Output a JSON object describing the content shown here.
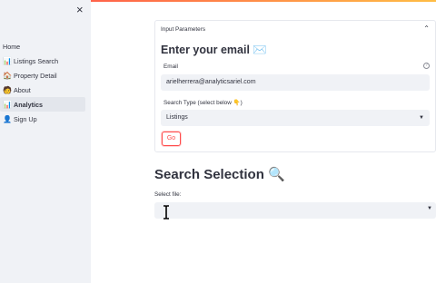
{
  "sidebar": {
    "close_label": "×",
    "home_label": "Home",
    "items": [
      {
        "label": "Listings Search",
        "icon": "bar-chart-icon",
        "glyph": "📊"
      },
      {
        "label": "Property Detail",
        "icon": "house-person-icon",
        "glyph": "🏠"
      },
      {
        "label": "About",
        "icon": "person-icon",
        "glyph": "🧑"
      },
      {
        "label": "Analytics",
        "icon": "bar-chart-icon",
        "glyph": "📊",
        "active": true
      },
      {
        "label": "Sign Up",
        "icon": "sign-up-icon",
        "glyph": "👤"
      }
    ]
  },
  "input_params": {
    "header": "Input Parameters",
    "chevron": "⌃",
    "title": "Enter your email ✉️",
    "email_label": "Email",
    "help_glyph": "?",
    "email_value": "arielherrera@analyticsariel.com",
    "search_type_label": "Search Type (select below 👇)",
    "search_type_value": "Listings",
    "go_label": "Go"
  },
  "search_selection": {
    "title": "Search Selection 🔍",
    "file_label": "Select file:",
    "file_value": ""
  },
  "colors": {
    "accent": "#ff4b4b",
    "sidebar_bg": "#f0f2f6",
    "text": "#31333f"
  }
}
